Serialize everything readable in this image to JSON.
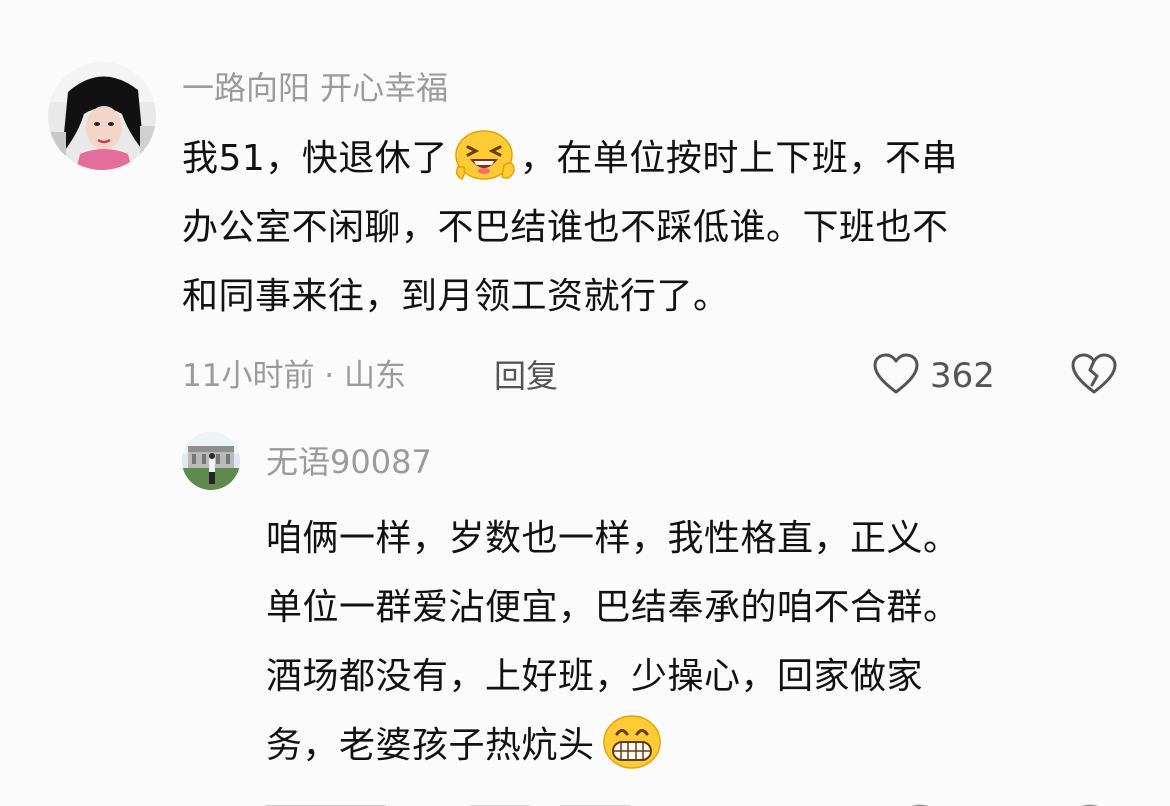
{
  "comment": {
    "username": "一路向阳  开心幸福",
    "text_line1_before_emoji": "我51，快退休了",
    "text_line1_after_emoji": "，在单位按时上下班，不串",
    "text_line2": "办公室不闲聊，不巴结谁也不踩低谁。下班也不",
    "text_line3": "和同事来往，到月领工资就行了。",
    "emoji_icon": "grinning-squint-emoji-icon",
    "meta": "11小时前 · 山东",
    "reply_label": "回复",
    "like_count": "362"
  },
  "reply": {
    "username": "无语90087",
    "text_line1": "咱俩一样，岁数也一样，我性格直，正义。",
    "text_line2": "单位一群爱沾便宜，巴结奉承的咱不合群。",
    "text_line3": "酒场都没有，上好班，少操心，回家做家",
    "text_line4_before_emoji": "务，老婆孩子热炕头",
    "emoji_icon": "big-grin-emoji-icon"
  },
  "colors": {
    "background": "#fbfbfb",
    "text": "#111111",
    "muted": "#9b9b9b",
    "action": "#555555"
  }
}
